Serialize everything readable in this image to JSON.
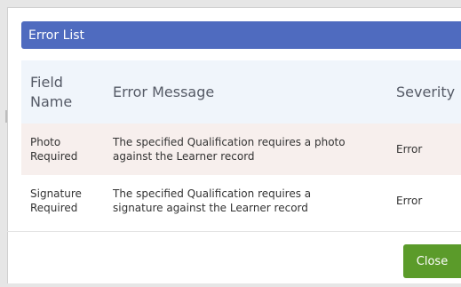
{
  "dialog": {
    "title": "Error List",
    "columns": {
      "field": [
        "Field",
        "Name"
      ],
      "message": "Error Message",
      "severity": "Severity"
    },
    "rows": [
      {
        "field": [
          "Photo",
          "Required"
        ],
        "message": [
          "The specified Qualification requires a photo",
          "against the Learner record"
        ],
        "severity": "Error"
      },
      {
        "field": [
          "Signature",
          "Required"
        ],
        "message": [
          "The specified Qualification requires a",
          "signature against the Learner record"
        ],
        "severity": "Error"
      }
    ],
    "close_label": "Close"
  },
  "colors": {
    "header": "#4f6bbf",
    "table_head": "#f0f5fb",
    "row_alt": "#f7efed",
    "close_button": "#5b9b2a"
  }
}
